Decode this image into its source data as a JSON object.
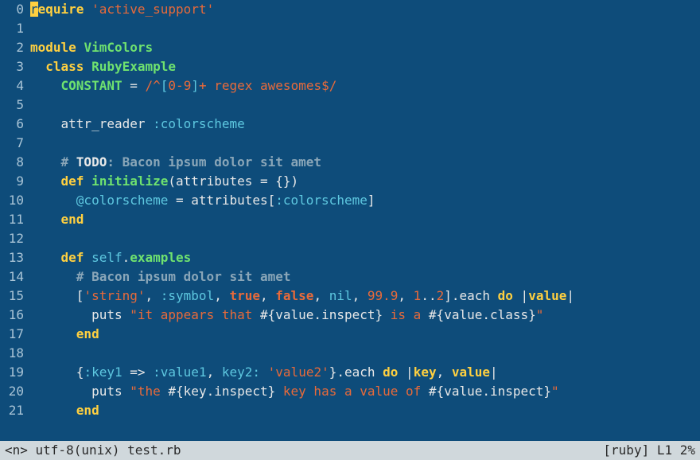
{
  "gutter": [
    "0",
    "1",
    "2",
    "3",
    "4",
    "5",
    "6",
    "7",
    "8",
    "9",
    "10",
    "11",
    "12",
    "13",
    "14",
    "15",
    "16",
    "17",
    "18",
    "19",
    "20",
    "21"
  ],
  "lines": [
    [
      {
        "c": "cursor",
        "t": "r"
      },
      {
        "c": "kw",
        "t": "equire"
      },
      {
        "c": "op",
        "t": " "
      },
      {
        "c": "str",
        "t": "'active_support'"
      }
    ],
    [],
    [
      {
        "c": "kw",
        "t": "module"
      },
      {
        "c": "op",
        "t": " "
      },
      {
        "c": "type",
        "t": "VimColors"
      }
    ],
    [
      {
        "c": "op",
        "t": "  "
      },
      {
        "c": "kw",
        "t": "class"
      },
      {
        "c": "op",
        "t": " "
      },
      {
        "c": "type",
        "t": "RubyExample"
      }
    ],
    [
      {
        "c": "op",
        "t": "    "
      },
      {
        "c": "type",
        "t": "CONSTANT"
      },
      {
        "c": "op",
        "t": " = "
      },
      {
        "c": "regex",
        "t": "/"
      },
      {
        "c": "regex",
        "t": "^"
      },
      {
        "c": "regexbr",
        "t": "["
      },
      {
        "c": "regex",
        "t": "0-9"
      },
      {
        "c": "regexbr",
        "t": "]"
      },
      {
        "c": "regex",
        "t": "+ regex awesomes$"
      },
      {
        "c": "regex",
        "t": "/"
      }
    ],
    [],
    [
      {
        "c": "op",
        "t": "    attr_reader "
      },
      {
        "c": "sym",
        "t": ":colorscheme"
      }
    ],
    [],
    [
      {
        "c": "op",
        "t": "    "
      },
      {
        "c": "comment",
        "t": "# "
      },
      {
        "c": "todo",
        "t": "TODO"
      },
      {
        "c": "comment",
        "t": ": Bacon ipsum dolor sit amet"
      }
    ],
    [
      {
        "c": "op",
        "t": "    "
      },
      {
        "c": "kw",
        "t": "def"
      },
      {
        "c": "op",
        "t": " "
      },
      {
        "c": "fname",
        "t": "initialize"
      },
      {
        "c": "op",
        "t": "(attributes = {})"
      }
    ],
    [
      {
        "c": "op",
        "t": "      "
      },
      {
        "c": "ivar",
        "t": "@colorscheme"
      },
      {
        "c": "op",
        "t": " = attributes["
      },
      {
        "c": "sym",
        "t": ":colorscheme"
      },
      {
        "c": "op",
        "t": "]"
      }
    ],
    [
      {
        "c": "op",
        "t": "    "
      },
      {
        "c": "kw",
        "t": "end"
      }
    ],
    [],
    [
      {
        "c": "op",
        "t": "    "
      },
      {
        "c": "kw",
        "t": "def"
      },
      {
        "c": "op",
        "t": " "
      },
      {
        "c": "self",
        "t": "self"
      },
      {
        "c": "op",
        "t": "."
      },
      {
        "c": "fname",
        "t": "examples"
      }
    ],
    [
      {
        "c": "op",
        "t": "      "
      },
      {
        "c": "comment",
        "t": "# Bacon ipsum dolor sit amet"
      }
    ],
    [
      {
        "c": "op",
        "t": "      ["
      },
      {
        "c": "str",
        "t": "'string'"
      },
      {
        "c": "op",
        "t": ", "
      },
      {
        "c": "sym",
        "t": ":symbol"
      },
      {
        "c": "op",
        "t": ", "
      },
      {
        "c": "bool",
        "t": "true"
      },
      {
        "c": "op",
        "t": ", "
      },
      {
        "c": "bool",
        "t": "false"
      },
      {
        "c": "op",
        "t": ", "
      },
      {
        "c": "nilv",
        "t": "nil"
      },
      {
        "c": "op",
        "t": ", "
      },
      {
        "c": "num",
        "t": "99.9"
      },
      {
        "c": "op",
        "t": ", "
      },
      {
        "c": "num",
        "t": "1"
      },
      {
        "c": "op",
        "t": ".."
      },
      {
        "c": "num",
        "t": "2"
      },
      {
        "c": "op",
        "t": "].each "
      },
      {
        "c": "kw",
        "t": "do"
      },
      {
        "c": "op",
        "t": " |"
      },
      {
        "c": "blockparam",
        "t": "value"
      },
      {
        "c": "op",
        "t": "|"
      }
    ],
    [
      {
        "c": "op",
        "t": "        puts "
      },
      {
        "c": "str",
        "t": "\"it appears that "
      },
      {
        "c": "strinterp",
        "t": "#{value.inspect}"
      },
      {
        "c": "str",
        "t": " is a "
      },
      {
        "c": "strinterp",
        "t": "#{value.class}"
      },
      {
        "c": "str",
        "t": "\""
      }
    ],
    [
      {
        "c": "op",
        "t": "      "
      },
      {
        "c": "kw",
        "t": "end"
      }
    ],
    [],
    [
      {
        "c": "op",
        "t": "      {"
      },
      {
        "c": "sym",
        "t": ":key1"
      },
      {
        "c": "op",
        "t": " => "
      },
      {
        "c": "sym",
        "t": ":value1"
      },
      {
        "c": "op",
        "t": ", "
      },
      {
        "c": "sym",
        "t": "key2:"
      },
      {
        "c": "op",
        "t": " "
      },
      {
        "c": "str",
        "t": "'value2'"
      },
      {
        "c": "op",
        "t": "}.each "
      },
      {
        "c": "kw",
        "t": "do"
      },
      {
        "c": "op",
        "t": " |"
      },
      {
        "c": "blockparam",
        "t": "key"
      },
      {
        "c": "op",
        "t": ", "
      },
      {
        "c": "blockparam",
        "t": "value"
      },
      {
        "c": "op",
        "t": "|"
      }
    ],
    [
      {
        "c": "op",
        "t": "        puts "
      },
      {
        "c": "str",
        "t": "\"the "
      },
      {
        "c": "strinterp",
        "t": "#{key.inspect}"
      },
      {
        "c": "str",
        "t": " key has a value of "
      },
      {
        "c": "strinterp",
        "t": "#{value.inspect}"
      },
      {
        "c": "str",
        "t": "\""
      }
    ],
    [
      {
        "c": "op",
        "t": "      "
      },
      {
        "c": "kw",
        "t": "end"
      }
    ]
  ],
  "status": {
    "left": "<n>  utf-8(unix) test.rb",
    "right": "[ruby] L1 2%"
  }
}
